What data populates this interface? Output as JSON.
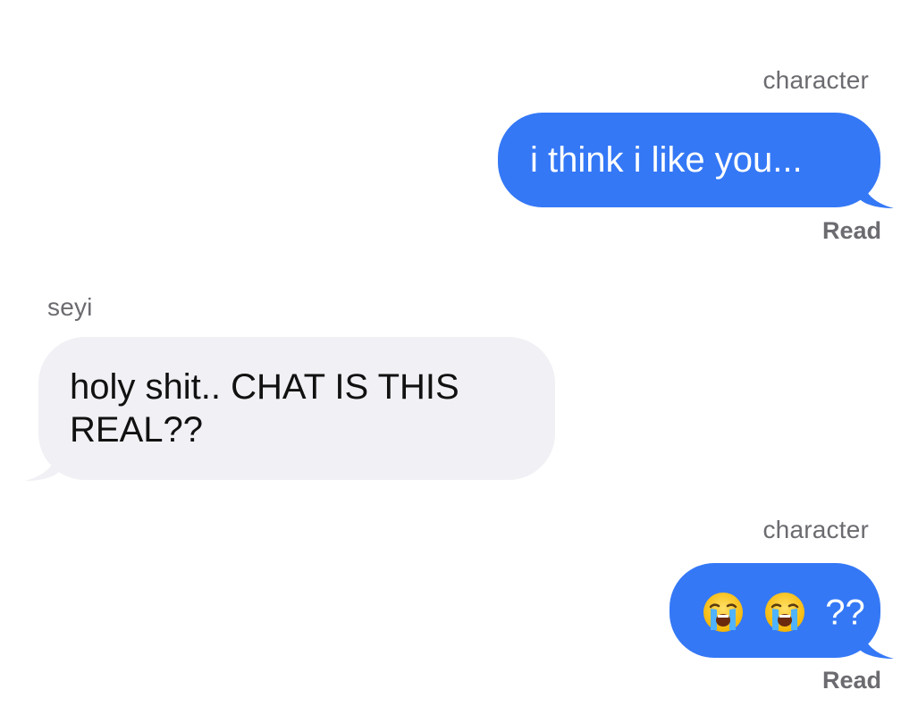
{
  "colors": {
    "outgoing_bubble": "#3478f6",
    "incoming_bubble": "#f0f0f5",
    "meta_text": "#6b6b70"
  },
  "messages": [
    {
      "sender": "character",
      "text": "i think i like you...",
      "status": "Read",
      "direction": "outgoing"
    },
    {
      "sender": "seyi",
      "text": "holy shit.. CHAT IS THIS REAL??",
      "direction": "incoming"
    },
    {
      "sender": "character",
      "emoji": [
        "loudly-crying-face-icon",
        "loudly-crying-face-icon"
      ],
      "text": "??",
      "status": "Read",
      "direction": "outgoing"
    }
  ]
}
